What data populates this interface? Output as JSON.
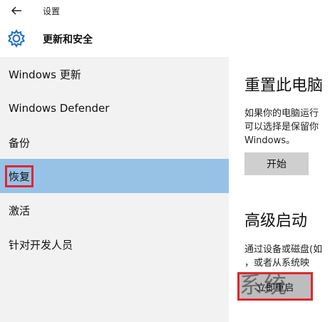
{
  "window": {
    "title": "设置"
  },
  "header": {
    "section_title": "更新和安全"
  },
  "nav": {
    "items": [
      {
        "label": "Windows 更新"
      },
      {
        "label": "Windows Defender"
      },
      {
        "label": "备份"
      },
      {
        "label": "恢复",
        "selected": true
      },
      {
        "label": "激活"
      },
      {
        "label": "针对开发人员"
      }
    ]
  },
  "reset": {
    "title": "重置此电脑",
    "desc": [
      "如果你的电脑运行",
      "可以选择是保留你",
      "Windows。"
    ],
    "button": "开始"
  },
  "advanced": {
    "title": "高级启动",
    "desc": [
      "通过设备或磁盘(如",
      "，或者从系统映"
    ],
    "button": "立即重启",
    "watermark": "系统"
  },
  "colors": {
    "selected_bg": "#97c2e8",
    "nav_bg": "#f2f2f2",
    "highlight_box": "#e0262f",
    "gear_blue": "#1e6fc0"
  }
}
